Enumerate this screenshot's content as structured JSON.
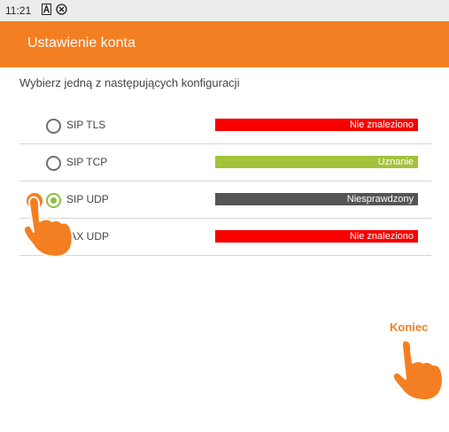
{
  "status_bar": {
    "time": "11:21",
    "icons": [
      "font-a-icon",
      "close-circle-icon"
    ]
  },
  "app_bar": {
    "title": "Ustawienie konta"
  },
  "instruction": "Wybierz jedną z następujących konfiguracji",
  "options": [
    {
      "label": "SIP TLS",
      "status": "Nie znaleziono",
      "status_color": "#f80000",
      "selected": false
    },
    {
      "label": "SIP TCP",
      "status": "Uznanie",
      "status_color": "#a3c33a",
      "selected": false
    },
    {
      "label": "SIP UDP",
      "status": "Niesprawdzony",
      "status_color": "#555555",
      "selected": true
    },
    {
      "label": "IAX UDP",
      "status": "Nie znaleziono",
      "status_color": "#f80000",
      "selected": false
    }
  ],
  "finish_label": "Koniec",
  "colors": {
    "accent": "#f37f22",
    "selected_radio": "#8fbf3f"
  },
  "hand_icons": [
    "pointing-hand-icon",
    "pointing-hand-icon"
  ]
}
